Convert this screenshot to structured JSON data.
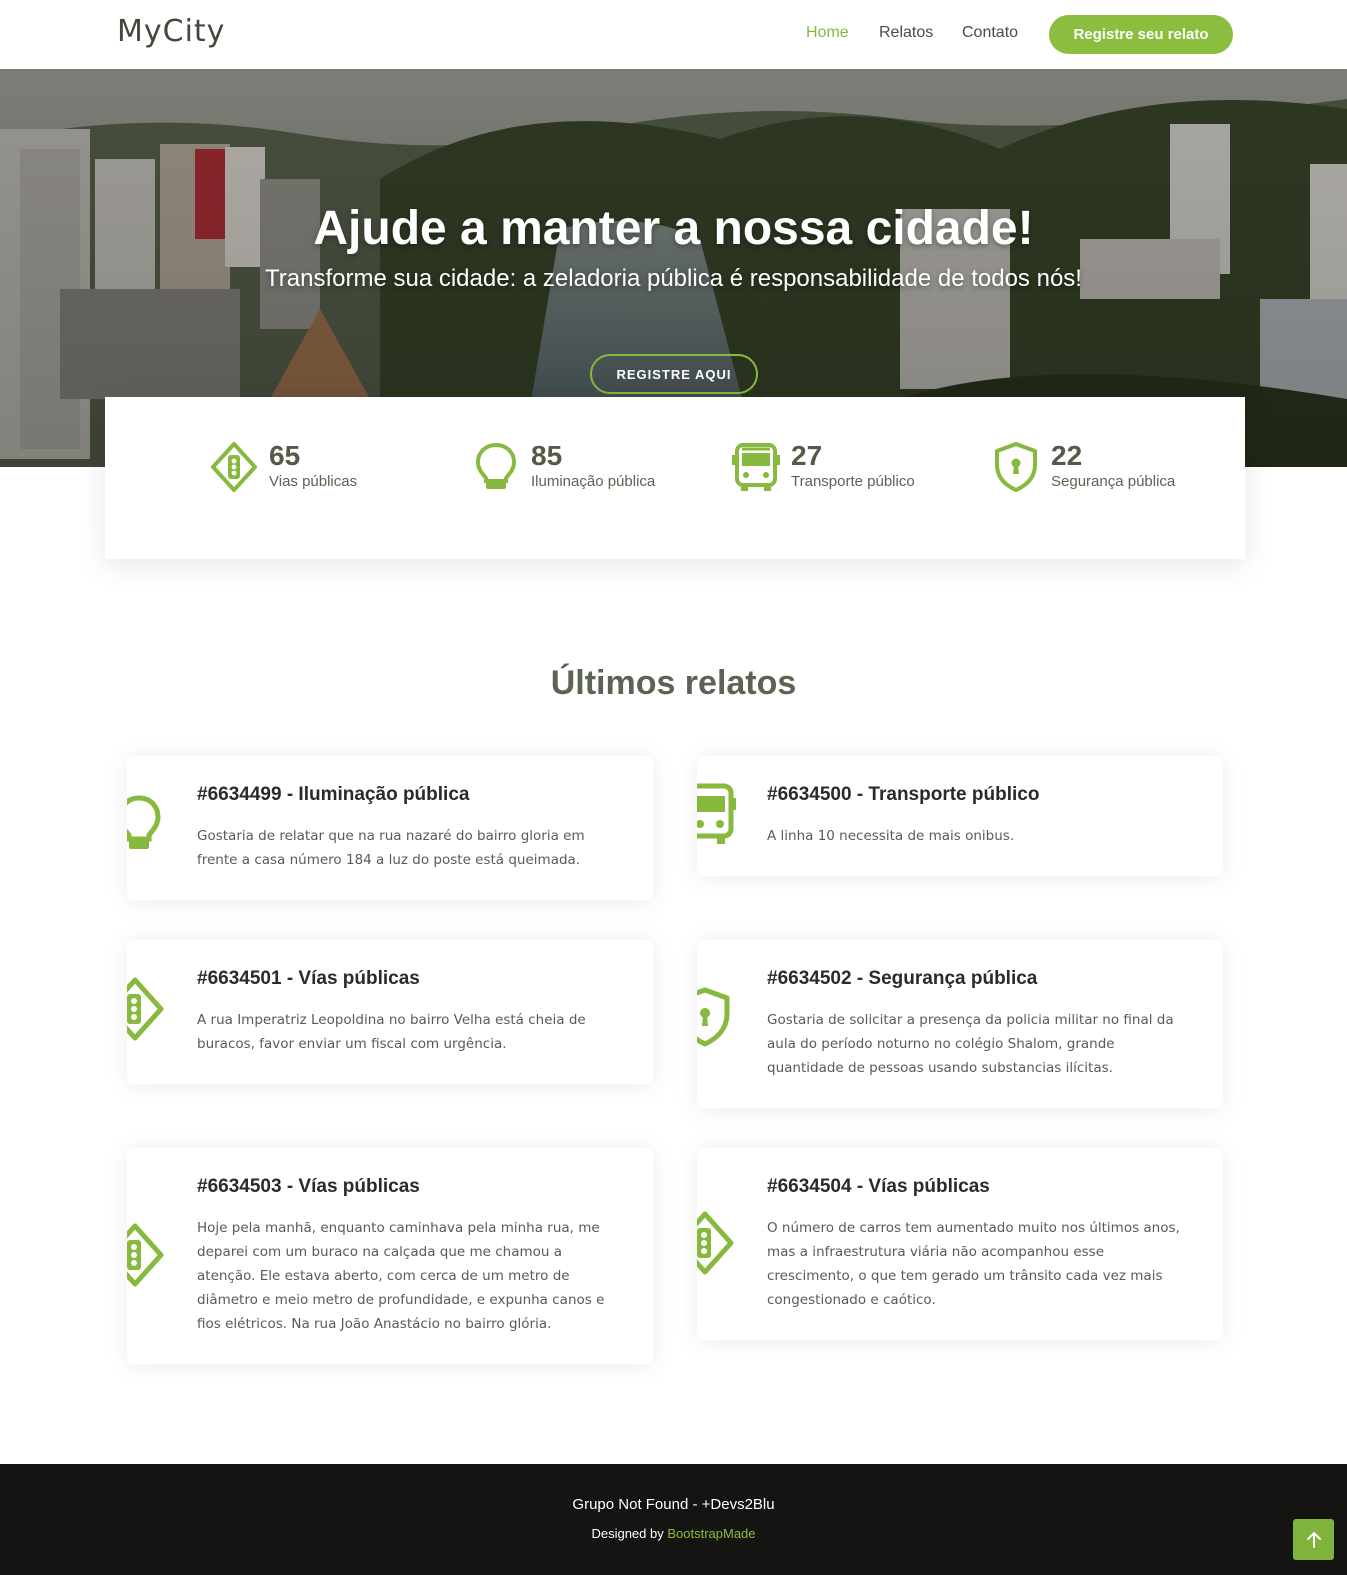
{
  "header": {
    "logo": "MyCity",
    "nav": [
      {
        "label": "Home"
      },
      {
        "label": "Relatos"
      },
      {
        "label": "Contato"
      }
    ],
    "cta": "Registre seu relato"
  },
  "hero": {
    "title": "Ajude a manter a nossa cidade!",
    "subtitle": "Transforme sua cidade: a zeladoria pública é responsabilidade de todos nós!",
    "button": "REGISTRE AQUI"
  },
  "stats": [
    {
      "value": "65",
      "label": "Vias públicas",
      "icon": "traffic-light-icon"
    },
    {
      "value": "85",
      "label": "Iluminação pública",
      "icon": "lightbulb-icon"
    },
    {
      "value": "27",
      "label": "Transporte público",
      "icon": "bus-icon"
    },
    {
      "value": "22",
      "label": "Segurança pública",
      "icon": "shield-icon"
    }
  ],
  "section": {
    "title": "Últimos relatos"
  },
  "reports": [
    {
      "title": "#6634499 - Iluminação pública",
      "description": "Gostaria de relatar que na rua nazaré do bairro gloria em frente a casa número 184 a luz do poste está queimada.",
      "icon": "lightbulb-icon"
    },
    {
      "title": "#6634500 - Transporte público",
      "description": "A linha 10 necessita de mais onibus.",
      "icon": "bus-icon"
    },
    {
      "title": "#6634501 - Vías públicas",
      "description": "A rua Imperatriz Leopoldina no bairro Velha está cheia de buracos, favor enviar um fiscal com urgência.",
      "icon": "traffic-light-icon"
    },
    {
      "title": "#6634502 - Segurança pública",
      "description": "Gostaria de solicitar a presença da policia militar no final da aula do período noturno no colégio Shalom, grande quantidade de pessoas usando substancias ilícitas.",
      "icon": "shield-icon"
    },
    {
      "title": "#6634503 - Vías públicas",
      "description": "Hoje pela manhã, enquanto caminhava pela minha rua, me deparei com um buraco na calçada que me chamou a atenção. Ele estava aberto, com cerca de um metro de diâmetro e meio metro de profundidade, e expunha canos e fios elétricos. Na rua João Anastácio no bairro glória.",
      "icon": "traffic-light-icon"
    },
    {
      "title": "#6634504 - Vías públicas",
      "description": "O número de carros tem aumentado muito nos últimos anos, mas a infraestrutura viária não acompanhou esse crescimento, o que tem gerado um trânsito cada vez mais congestionado e caótico.",
      "icon": "traffic-light-icon"
    }
  ],
  "footer": {
    "line1": "Grupo Not Found - +Devs2Blu",
    "designed_prefix": "Designed by",
    "designed_link": "BootstrapMade"
  },
  "colors": {
    "accent": "#8bbd3f",
    "footer_bg": "#141513"
  }
}
